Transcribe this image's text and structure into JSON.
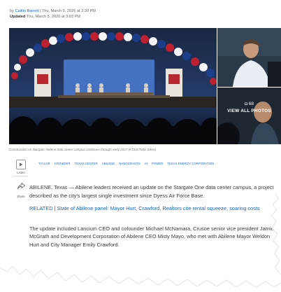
{
  "byline": {
    "prefix": "by",
    "author": "Caitlin Barrett",
    "published": "| Thu, March 5, 2026 at 2:30 PM",
    "updated_label": "Updated",
    "updated": "Thu, March 5, 2026 at 3:03 PM"
  },
  "gallery": {
    "photo_count": "68",
    "view_label": "VIEW ALL PHOTOS"
  },
  "caption": "Construction on Stargate Abilene data center campus continues through early 2027 (KTXS/Todd Jakes)",
  "actions": {
    "listen_label": "Listen",
    "share_label": "Share"
  },
  "tags": [
    "TAYLOR",
    "CROWDER",
    "TEXAS CENTER",
    "ABILENE",
    "NANOGRANTS",
    "AI",
    "POWER",
    "TEXAS ENERGY CORPORATION"
  ],
  "article": {
    "lead": "ABILENE, Texas — Abilene leaders received an update on the Stargate One data center campus, a project described as the city's largest single investment since Dyess Air Force Base.",
    "related_label": "RELATED",
    "related_link": "State of Abilene panel: Mayor Hurt, Crawford, Realtors cite rental squeeze, soaring costs",
    "para2": "The update included Lancium CEO and cofounder Michael McNamara, Crusoe senior vice president Jamie McGrath and Development Corporation of Abilene CEO Misty Mayo, who met with Abilene Mayor Weldon Hurt and City Manager Emily Crawford."
  }
}
